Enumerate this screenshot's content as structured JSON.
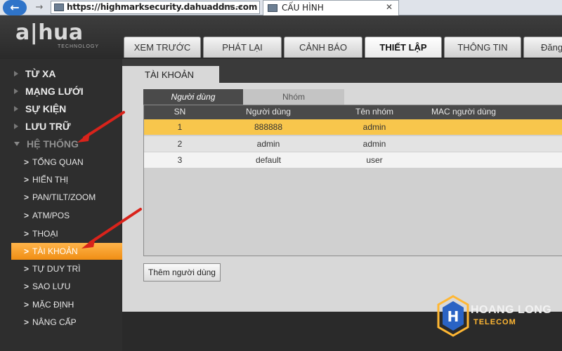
{
  "browser": {
    "back_icon": "←",
    "forward_icon": "→",
    "url": "https://highmarksecurity.dahuaddns.com",
    "address_controls": "⌕ ▾ →",
    "tab_title": "CẤU HÌNH",
    "tab_close": "✕"
  },
  "app": {
    "logo": "a|hua",
    "logo_sub": "TECHNOLOGY"
  },
  "main_tabs": [
    {
      "label": "XEM TRƯỚC"
    },
    {
      "label": "PHÁT LẠI"
    },
    {
      "label": "CẢNH BÁO"
    },
    {
      "label": "THIẾT LẬP"
    },
    {
      "label": "THÔNG TIN"
    },
    {
      "label": "Đăng"
    }
  ],
  "sidebar": {
    "categories": [
      {
        "label": "TỪ XA"
      },
      {
        "label": "MẠNG LƯỚI"
      },
      {
        "label": "SỰ KIỆN"
      },
      {
        "label": "LƯU TRỮ"
      },
      {
        "label": "HỆ THỐNG"
      }
    ],
    "subitems": [
      {
        "label": "TỔNG QUAN"
      },
      {
        "label": "HIỂN THỊ"
      },
      {
        "label": "PAN/TILT/ZOOM"
      },
      {
        "label": "ATM/POS"
      },
      {
        "label": "THOẠI"
      },
      {
        "label": "TÀI KHOẢN"
      },
      {
        "label": "TỰ DUY TRÌ"
      },
      {
        "label": "SAO LƯU"
      },
      {
        "label": "MẶC ĐỊNH"
      },
      {
        "label": "NÂNG CẤP"
      }
    ],
    "chevron": ">"
  },
  "content": {
    "section_title": "TÀI KHOẢN",
    "subtabs": {
      "users": "Người dùng",
      "group": "Nhóm"
    },
    "columns": [
      "SN",
      "Người dùng",
      "Tên nhóm",
      "MAC người dùng"
    ],
    "rows": [
      {
        "sn": "1",
        "user": "888888",
        "group": "admin",
        "mac": ""
      },
      {
        "sn": "2",
        "user": "admin",
        "group": "admin",
        "mac": ""
      },
      {
        "sn": "3",
        "user": "default",
        "group": "user",
        "mac": ""
      }
    ],
    "add_button": "Thêm người dùng"
  },
  "watermark": {
    "brand": "HOANG LONG",
    "sub": "TELECOM"
  },
  "colors": {
    "accent_orange": "#f08e14",
    "selected_row": "#f8c64c",
    "annotation_red": "#d9231b"
  }
}
